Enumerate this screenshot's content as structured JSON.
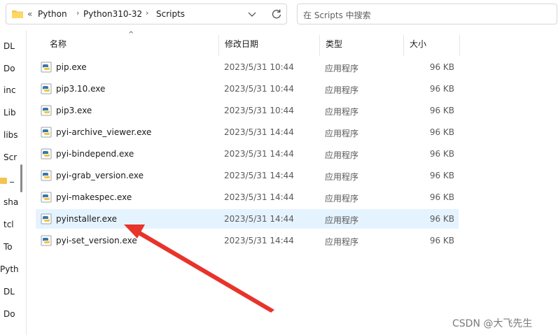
{
  "address_bar": {
    "overflow": "«",
    "path": [
      "Python",
      "Python310-32",
      "Scripts"
    ]
  },
  "search": {
    "placeholder": "在 Scripts 中搜索"
  },
  "nav": {
    "items": [
      "DL",
      "Do",
      "inc",
      "Lib",
      "libs",
      "Scr",
      "_",
      "sha",
      "tcl",
      "To",
      "Pyth",
      "DL",
      "Do"
    ]
  },
  "columns": {
    "name": "名称",
    "modified": "修改日期",
    "type": "类型",
    "size": "大小"
  },
  "files": [
    {
      "name": "pip.exe",
      "modified": "2023/5/31 10:44",
      "type": "应用程序",
      "size": "96 KB",
      "icon": "python-icon"
    },
    {
      "name": "pip3.10.exe",
      "modified": "2023/5/31 10:44",
      "type": "应用程序",
      "size": "96 KB",
      "icon": "python-icon"
    },
    {
      "name": "pip3.exe",
      "modified": "2023/5/31 10:44",
      "type": "应用程序",
      "size": "96 KB",
      "icon": "python-icon"
    },
    {
      "name": "pyi-archive_viewer.exe",
      "modified": "2023/5/31 14:44",
      "type": "应用程序",
      "size": "96 KB",
      "icon": "python-icon"
    },
    {
      "name": "pyi-bindepend.exe",
      "modified": "2023/5/31 14:44",
      "type": "应用程序",
      "size": "96 KB",
      "icon": "python-icon"
    },
    {
      "name": "pyi-grab_version.exe",
      "modified": "2023/5/31 14:44",
      "type": "应用程序",
      "size": "96 KB",
      "icon": "python-icon"
    },
    {
      "name": "pyi-makespec.exe",
      "modified": "2023/5/31 14:44",
      "type": "应用程序",
      "size": "96 KB",
      "icon": "python-icon"
    },
    {
      "name": "pyinstaller.exe",
      "modified": "2023/5/31 14:44",
      "type": "应用程序",
      "size": "96 KB",
      "icon": "python-icon",
      "selected": true
    },
    {
      "name": "pyi-set_version.exe",
      "modified": "2023/5/31 14:44",
      "type": "应用程序",
      "size": "96 KB",
      "icon": "python-icon"
    }
  ],
  "annotation": {
    "color": "#e8332a",
    "points_to": "pyinstaller.exe"
  },
  "watermark": "CSDN @大飞先生"
}
